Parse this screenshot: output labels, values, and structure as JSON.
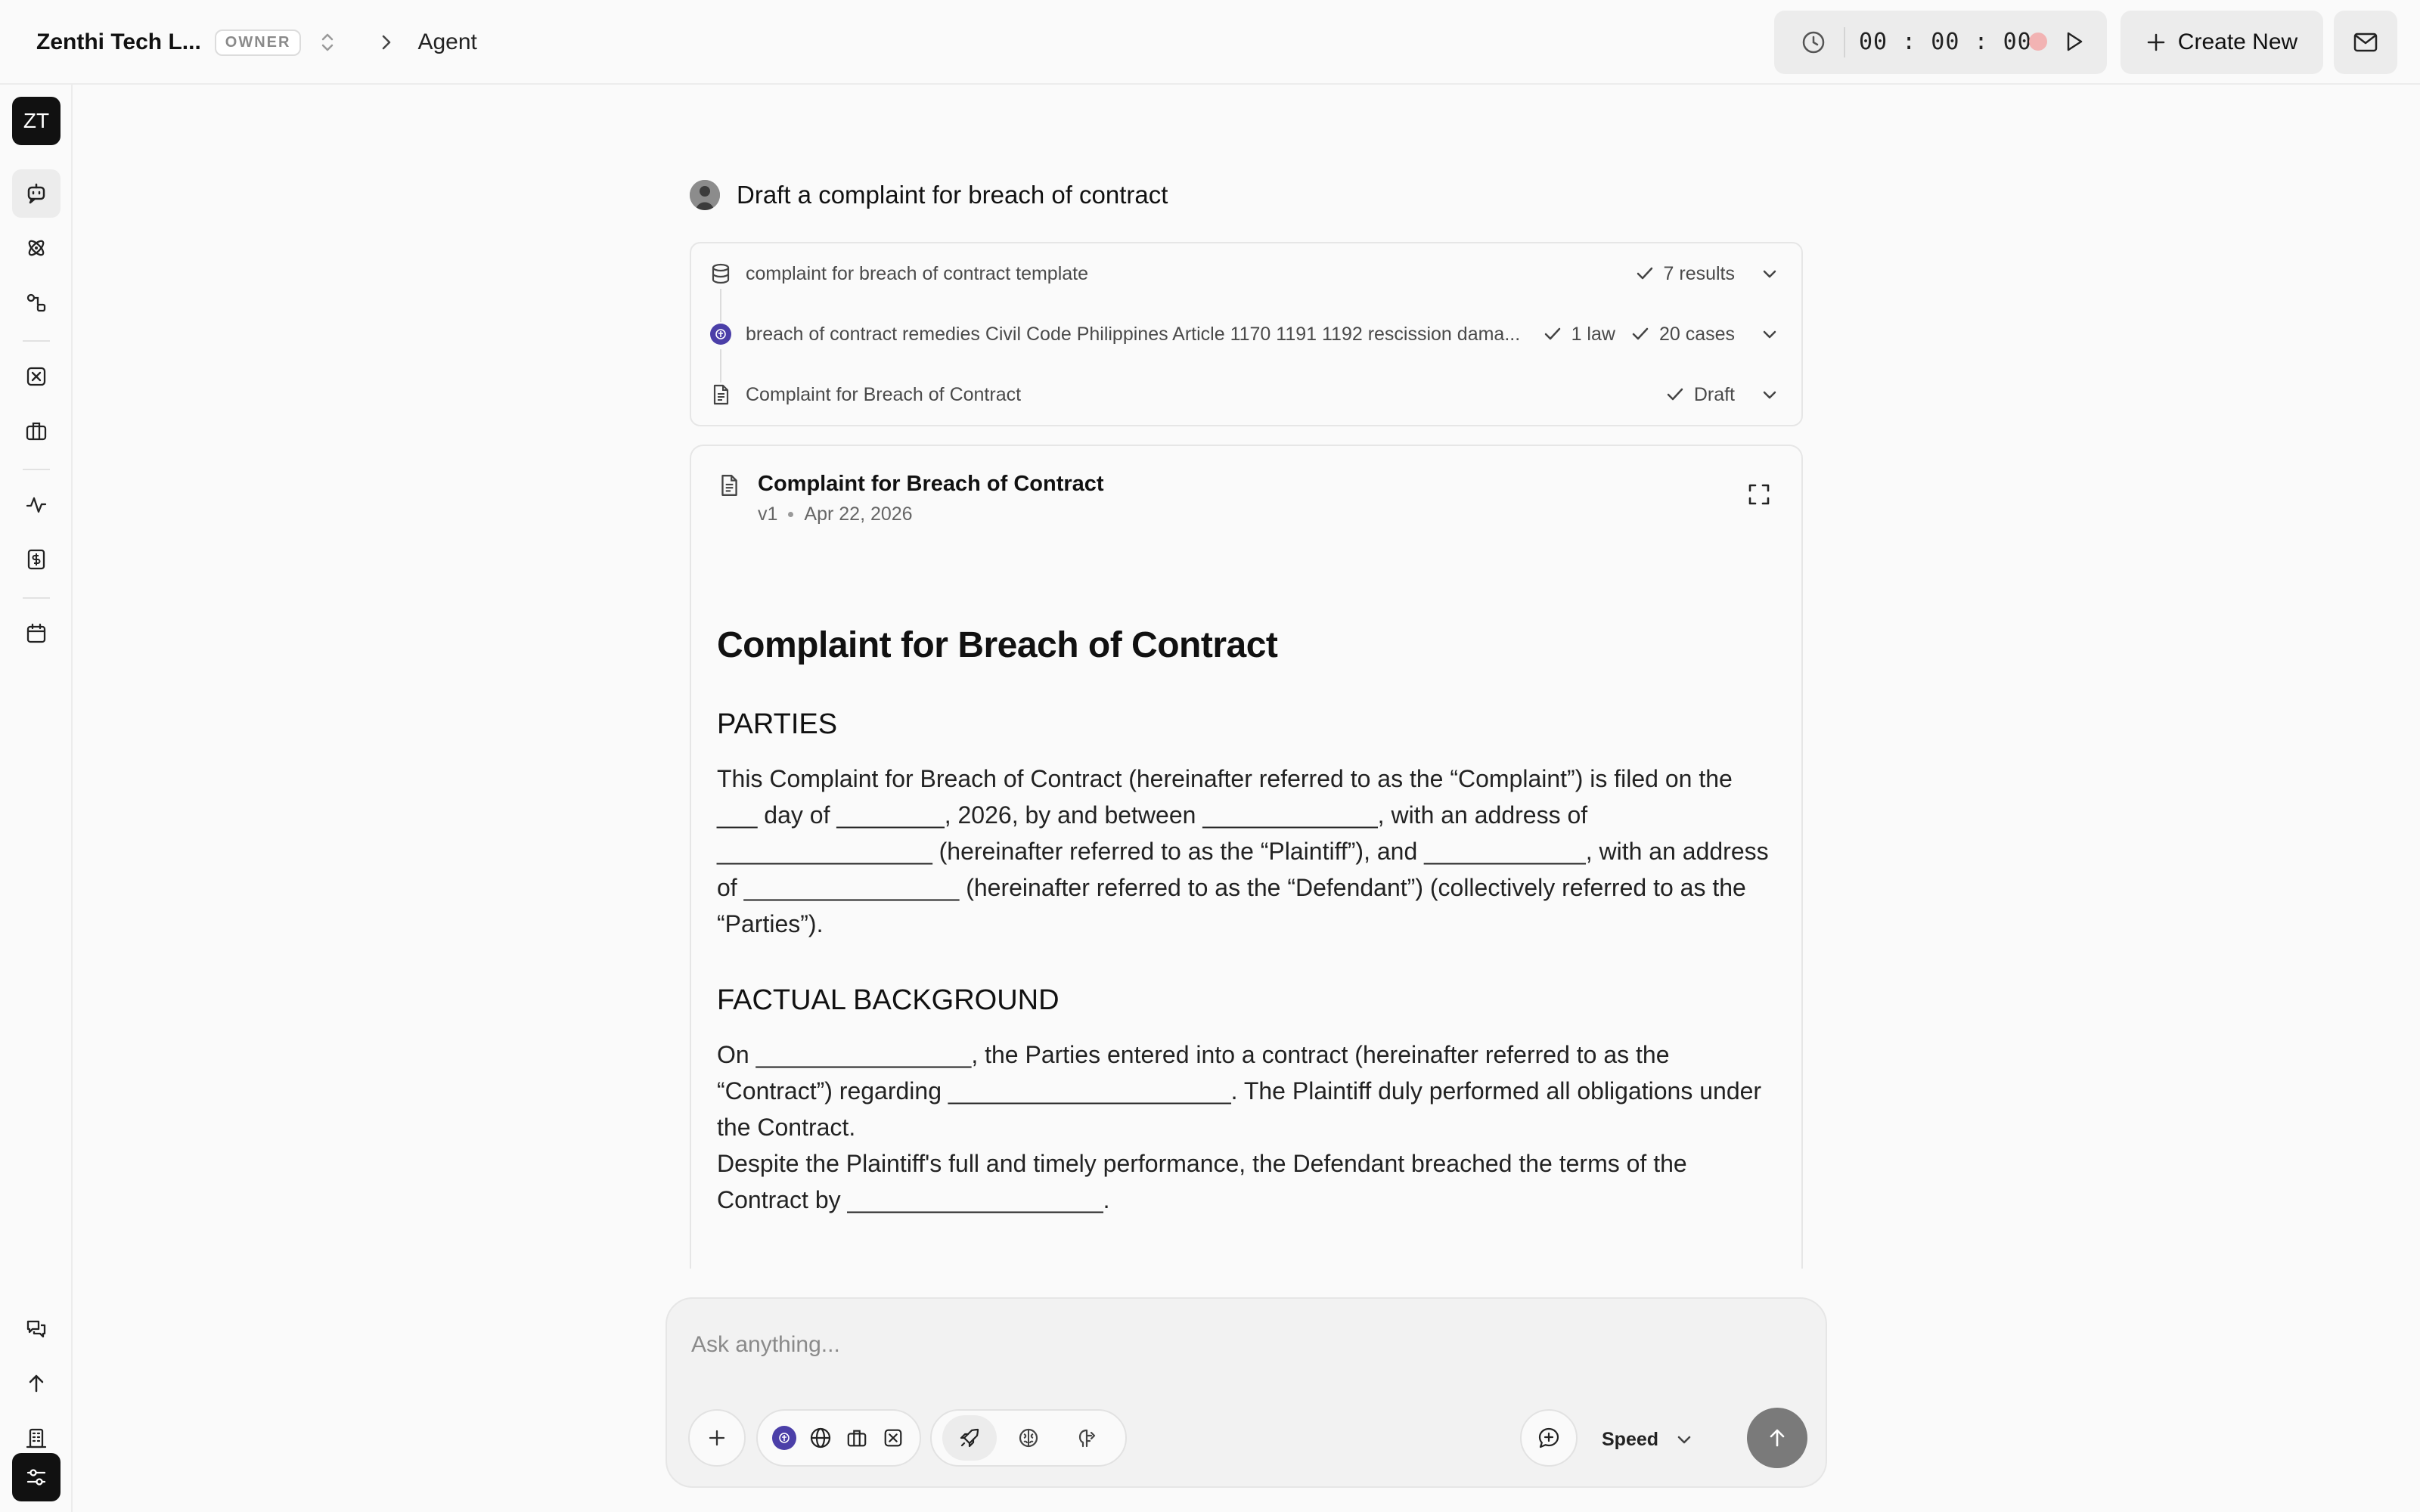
{
  "header": {
    "org_name": "Zenthi Tech L...",
    "role_badge": "OWNER",
    "breadcrumb": "Agent",
    "timer": "00 : 00 : 00",
    "create_new_label": "Create New"
  },
  "sidebar": {
    "workspace_initials": "ZT",
    "items": [
      {
        "icon": "chat-bot-icon",
        "active": true
      },
      {
        "icon": "atom-icon"
      },
      {
        "icon": "workflow-icon"
      },
      {
        "icon": "x-box-icon"
      },
      {
        "icon": "briefcase-icon"
      },
      {
        "icon": "activity-icon"
      },
      {
        "icon": "billing-icon"
      },
      {
        "icon": "calendar-icon"
      }
    ],
    "bottom_items": [
      {
        "icon": "messages-icon"
      },
      {
        "icon": "arrow-up-icon"
      },
      {
        "icon": "building-icon"
      },
      {
        "icon": "settings-sliders-icon"
      }
    ]
  },
  "conversation": {
    "prompt": "Draft a complaint for breach of contract",
    "steps": [
      {
        "icon": "database-icon",
        "text": "complaint for breach of contract template",
        "result": "7 results"
      },
      {
        "icon": "civil-code-icon",
        "text": "breach of contract remedies Civil Code Philippines Article 1170 1191 1192 rescission dama...",
        "result_1": "1 law",
        "result_2": "20 cases"
      },
      {
        "icon": "document-icon",
        "text": "Complaint for Breach of Contract",
        "result": "Draft"
      }
    ]
  },
  "document": {
    "header_title": "Complaint for Breach of Contract",
    "version": "v1",
    "date": "Apr 22, 2026",
    "title": "Complaint for Breach of Contract",
    "section_parties": "PARTIES",
    "parties_text": "This Complaint for Breach of Contract (hereinafter referred to as the “Complaint”) is filed on the ___ day of ________, 2026, by and between _____________, with an address of ________________ (hereinafter referred to as the “Plaintiff”), and ____________, with an address of ________________ (hereinafter referred to as the “Defendant”) (collectively referred to as the “Parties”).",
    "section_background": "FACTUAL BACKGROUND",
    "background_text_1": "On ________________, the Parties entered into a contract (hereinafter referred to as the “Contract”) regarding _____________________. The Plaintiff duly performed all obligations under the Contract.",
    "background_text_2": "Despite the Plaintiff's full and timely performance, the Defendant breached the terms of the Contract by ___________________."
  },
  "composer": {
    "placeholder": "Ask anything...",
    "mode_label": "Speed"
  }
}
